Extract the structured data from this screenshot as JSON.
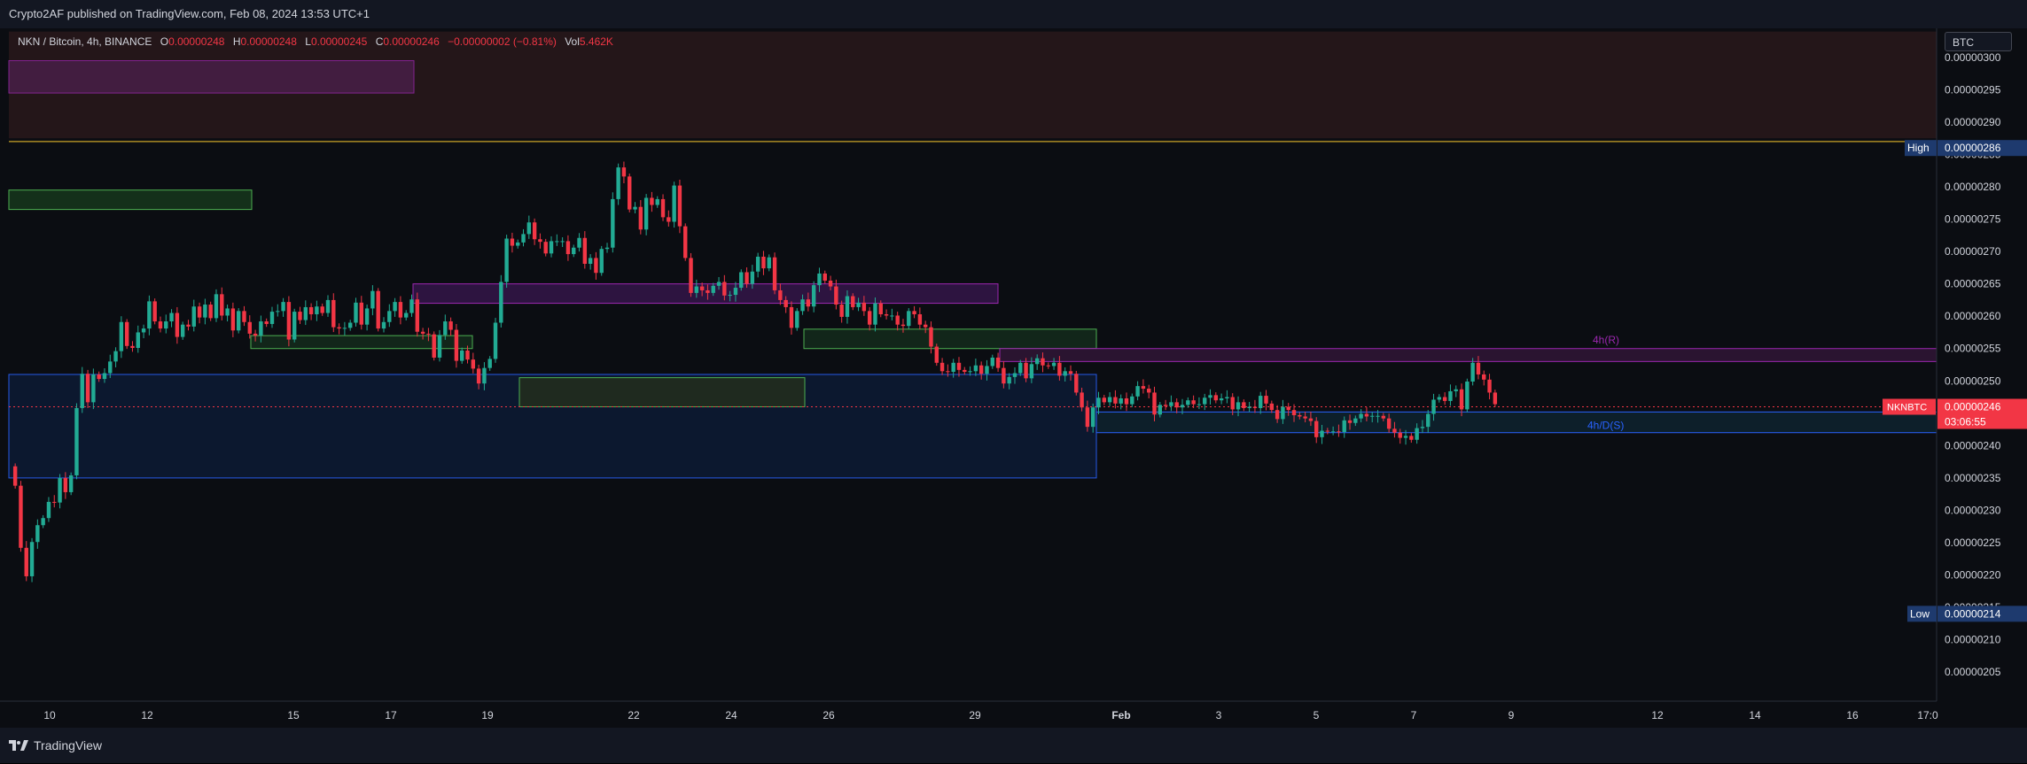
{
  "header": {
    "published": "Crypto2AF published on TradingView.com, Feb 08, 2024 13:53 UTC+1"
  },
  "legend": {
    "symbol": "NKN / Bitcoin, 4h, BINANCE",
    "o_label": "O",
    "o_value": "0.00000248",
    "h_label": "H",
    "h_value": "0.00000248",
    "l_label": "L",
    "l_value": "0.00000245",
    "c_label": "C",
    "c_value": "0.00000246",
    "change": "−0.00000002 (−0.81%)",
    "vol_label": "Vol",
    "vol_value": "5.462K"
  },
  "unit": "BTC",
  "footer": {
    "brand": "TradingView"
  },
  "colors": {
    "up": "#22ab94",
    "down": "#f23645",
    "high_line": "#c9a227",
    "price_tag": "#f23645",
    "hl_tag": "#1e3a6e",
    "zone_blue": "#2962ff",
    "zone_purple": "#9c27b0",
    "zone_green": "#4caf50"
  },
  "chart_data": {
    "type": "candlestick",
    "symbol": "NKNBTC",
    "timeframe": "4h",
    "exchange": "BINANCE",
    "ylim": [
      2.005e-06,
      3.045e-06
    ],
    "y_ticks": [
      "0.00000300",
      "0.00000295",
      "0.00000290",
      "0.00000285",
      "0.00000280",
      "0.00000275",
      "0.00000270",
      "0.00000265",
      "0.00000260",
      "0.00000255",
      "0.00000250",
      "0.00000245",
      "0.00000240",
      "0.00000235",
      "0.00000230",
      "0.00000225",
      "0.00000220",
      "0.00000215",
      "0.00000210",
      "0.00000205"
    ],
    "x_ticks": [
      "10",
      "12",
      "15",
      "17",
      "19",
      "22",
      "24",
      "26",
      "29",
      "Feb",
      "3",
      "5",
      "7",
      "9",
      "12",
      "14",
      "16",
      "17:0"
    ],
    "annotations": {
      "high_label": "High",
      "high_value": "0.00000286",
      "low_label": "Low",
      "low_value": "0.00000214",
      "last_label": "NKNBTC",
      "last_value": "0.00000246",
      "countdown": "03:06:55",
      "zone_r_label": "4h(R)",
      "zone_s_label": "4h/D(S)"
    },
    "closes": [
      2.338e-06,
      2.242e-06,
      2.198e-06,
      2.251e-06,
      2.277e-06,
      2.288e-06,
      2.313e-06,
      2.312e-06,
      2.35e-06,
      2.328e-06,
      2.354e-06,
      2.458e-06,
      2.511e-06,
      2.467e-06,
      2.51e-06,
      2.503e-06,
      2.512e-06,
      2.53e-06,
      2.546e-06,
      2.591e-06,
      2.554e-06,
      2.551e-06,
      2.575e-06,
      2.581e-06,
      2.623e-06,
      2.592e-06,
      2.581e-06,
      2.592e-06,
      2.605e-06,
      2.568e-06,
      2.587e-06,
      2.584e-06,
      2.615e-06,
      2.598e-06,
      2.618e-06,
      2.597e-06,
      2.634e-06,
      2.601e-06,
      2.612e-06,
      2.578e-06,
      2.608e-06,
      2.591e-06,
      2.573e-06,
      2.57e-06,
      2.592e-06,
      2.588e-06,
      2.607e-06,
      2.608e-06,
      2.622e-06,
      2.564e-06,
      2.607e-06,
      2.594e-06,
      2.614e-06,
      2.603e-06,
      2.615e-06,
      2.605e-06,
      2.625e-06,
      2.583e-06,
      2.581e-06,
      2.582e-06,
      2.59e-06,
      2.621e-06,
      2.587e-06,
      2.612e-06,
      2.639e-06,
      2.581e-06,
      2.591e-06,
      2.608e-06,
      2.622e-06,
      2.598e-06,
      2.605e-06,
      2.626e-06,
      2.576e-06,
      2.573e-06,
      2.572e-06,
      2.536e-06,
      2.571e-06,
      2.592e-06,
      2.579e-06,
      2.531e-06,
      2.547e-06,
      2.533e-06,
      2.519e-06,
      2.496e-06,
      2.52e-06,
      2.534e-06,
      2.59e-06,
      2.653e-06,
      2.72e-06,
      2.709e-06,
      2.714e-06,
      2.727e-06,
      2.745e-06,
      2.719e-06,
      2.715e-06,
      2.697e-06,
      2.716e-06,
      2.716e-06,
      2.716e-06,
      2.696e-06,
      2.706e-06,
      2.721e-06,
      2.681e-06,
      2.69e-06,
      2.667e-06,
      2.704e-06,
      2.706e-06,
      2.781e-06,
      2.83e-06,
      2.816e-06,
      2.765e-06,
      2.769e-06,
      2.734e-06,
      2.783e-06,
      2.772e-06,
      2.781e-06,
      2.753e-06,
      2.746e-06,
      2.802e-06,
      2.739e-06,
      2.69e-06,
      2.636e-06,
      2.646e-06,
      2.64e-06,
      2.636e-06,
      2.647e-06,
      2.653e-06,
      2.632e-06,
      2.633e-06,
      2.644e-06,
      2.668e-06,
      2.65e-06,
      2.669e-06,
      2.692e-06,
      2.674e-06,
      2.691e-06,
      2.64e-06,
      2.625e-06,
      2.614e-06,
      2.582e-06,
      2.608e-06,
      2.626e-06,
      2.615e-06,
      2.648e-06,
      2.666e-06,
      2.655e-06,
      2.646e-06,
      2.618e-06,
      2.599e-06,
      2.631e-06,
      2.614e-06,
      2.621e-06,
      2.608e-06,
      2.587e-06,
      2.62e-06,
      2.603e-06,
      2.601e-06,
      2.601e-06,
      2.587e-06,
      2.585e-06,
      2.608e-06,
      2.603e-06,
      2.587e-06,
      2.583e-06,
      2.553e-06,
      2.528e-06,
      2.515e-06,
      2.514e-06,
      2.528e-06,
      2.517e-06,
      2.514e-06,
      2.515e-06,
      2.524e-06,
      2.511e-06,
      2.523e-06,
      2.536e-06,
      2.52e-06,
      2.496e-06,
      2.506e-06,
      2.512e-06,
      2.528e-06,
      2.504e-06,
      2.526e-06,
      2.535e-06,
      2.524e-06,
      2.523e-06,
      2.528e-06,
      2.508e-06,
      2.515e-06,
      2.511e-06,
      2.482e-06,
      2.459e-06,
      2.429e-06,
      2.459e-06,
      2.474e-06,
      2.467e-06,
      2.475e-06,
      2.465e-06,
      2.473e-06,
      2.464e-06,
      2.476e-06,
      2.492e-06,
      2.488e-06,
      2.482e-06,
      2.448e-06,
      2.463e-06,
      2.461e-06,
      2.467e-06,
      2.459e-06,
      2.463e-06,
      2.47e-06,
      2.464e-06,
      2.464e-06,
      2.474e-06,
      2.478e-06,
      2.47e-06,
      2.473e-06,
      2.475e-06,
      2.456e-06,
      2.467e-06,
      2.458e-06,
      2.46e-06,
      2.458e-06,
      2.477e-06,
      2.465e-06,
      2.455e-06,
      2.441e-06,
      2.46e-06,
      2.455e-06,
      2.447e-06,
      2.445e-06,
      2.442e-06,
      2.438e-06,
      2.413e-06,
      2.423e-06,
      2.422e-06,
      2.422e-06,
      2.421e-06,
      2.439e-06,
      2.435e-06,
      2.442e-06,
      2.449e-06,
      2.445e-06,
      2.446e-06,
      2.446e-06,
      2.442e-06,
      2.426e-06,
      2.42e-06,
      2.412e-06,
      2.415e-06,
      2.409e-06,
      2.427e-06,
      2.429e-06,
      2.449e-06,
      2.471e-06,
      2.475e-06,
      2.469e-06,
      2.484e-06,
      2.487e-06,
      2.456e-06,
      2.499e-06,
      2.528e-06,
      2.51e-06,
      2.502e-06,
      2.482e-06,
      2.464e-06
    ],
    "opens_offset_note": ""
  }
}
